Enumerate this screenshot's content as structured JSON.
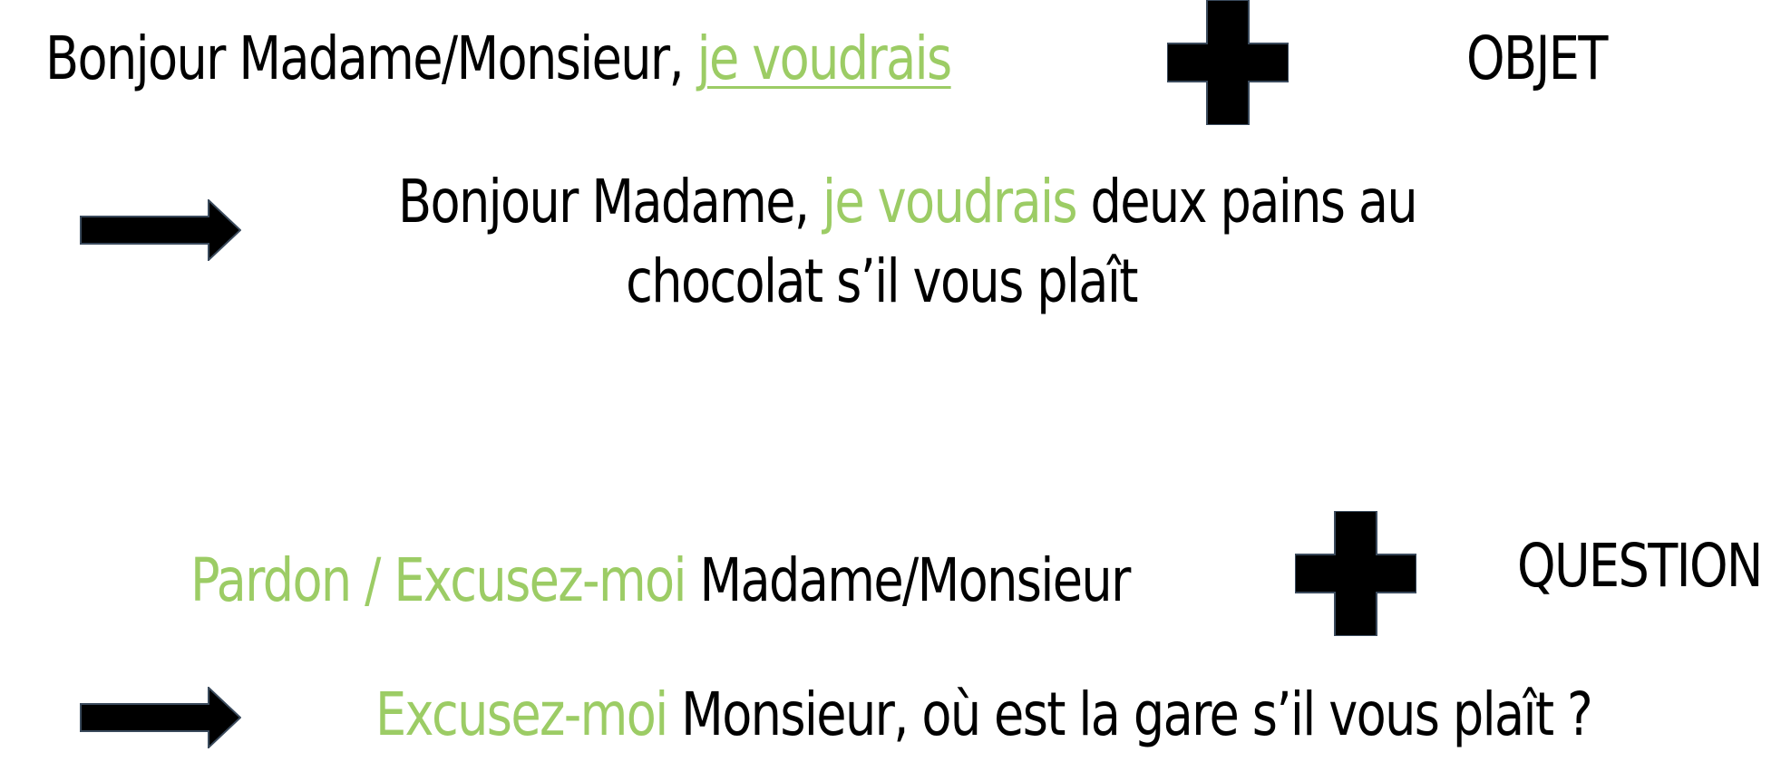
{
  "colors": {
    "accent_green": "#9ccc65",
    "text": "#000000",
    "background": "#ffffff"
  },
  "rule1": {
    "greeting": "Bonjour Madame/Monsieur, ",
    "phrase": "je voudrais",
    "operator_icon": "plus-icon",
    "object_label": "OBJET",
    "example": {
      "arrow_icon": "arrow-right-icon",
      "part1": "Bonjour Madame, ",
      "phrase": "je voudrais",
      "part2": " deux pains au",
      "line2": "chocolat s’il vous plaît"
    }
  },
  "rule2": {
    "phrase": "Pardon / Excusez-moi",
    "address": " Madame/Monsieur",
    "operator_icon": "plus-icon",
    "question_label": "QUESTION",
    "example": {
      "arrow_icon": "arrow-right-icon",
      "phrase": "Excusez-moi",
      "rest": " Monsieur, où est la gare s’il vous plaît ?"
    }
  }
}
